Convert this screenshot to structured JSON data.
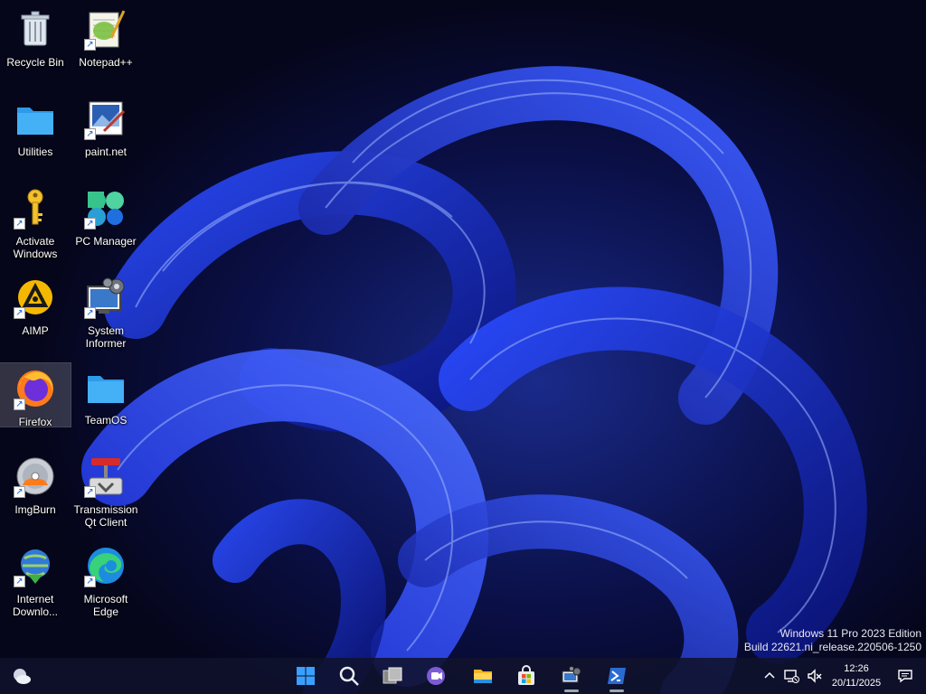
{
  "desktop": {
    "icons": [
      {
        "label": "Recycle Bin"
      },
      {
        "label": "Notepad++"
      },
      {
        "label": "Utilities"
      },
      {
        "label": "paint.net"
      },
      {
        "label": "Activate Windows"
      },
      {
        "label": "PC Manager"
      },
      {
        "label": "AIMP"
      },
      {
        "label": "System Informer"
      },
      {
        "label": "Firefox"
      },
      {
        "label": "TeamOS"
      },
      {
        "label": "ImgBurn"
      },
      {
        "label": "Transmission Qt Client"
      },
      {
        "label": "Internet Downlo..."
      },
      {
        "label": "Microsoft Edge"
      }
    ],
    "selected_icon": "Firefox"
  },
  "watermark": {
    "line1": "Windows 11 Pro 2023 Edition",
    "line2": "Build 22621.ni_release.220506-1250"
  },
  "taskbar": {
    "left_widget": "weather-widget-icon",
    "pinned": [
      {
        "icon": "start-icon"
      },
      {
        "icon": "search-icon"
      },
      {
        "icon": "task-view-icon"
      },
      {
        "icon": "teams-chat-icon"
      },
      {
        "icon": "file-explorer-icon"
      },
      {
        "icon": "microsoft-store-icon"
      },
      {
        "icon": "system-informer-icon"
      },
      {
        "icon": "powershell-icon"
      }
    ],
    "tray": {
      "time": "12:26",
      "date": "20/11/2025"
    }
  },
  "colors": {
    "background": "#05061a",
    "wallpaper_accent": "#1f3cff",
    "taskbar": "#10122c"
  }
}
